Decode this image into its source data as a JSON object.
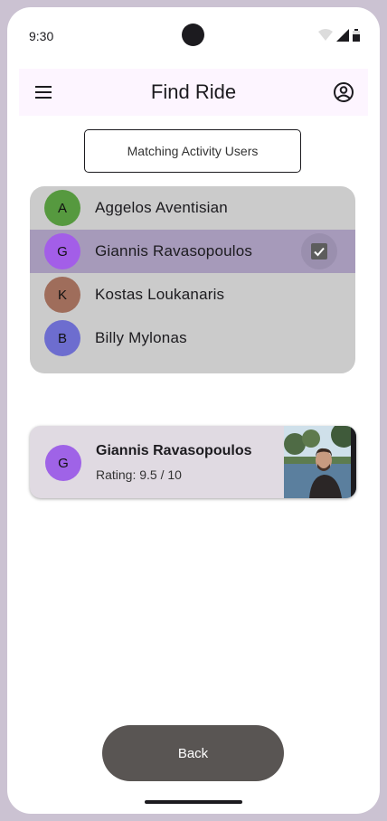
{
  "status_bar": {
    "time": "9:30"
  },
  "app_bar": {
    "title": "Find Ride"
  },
  "matching_button": {
    "label": "Matching Activity Users"
  },
  "users": [
    {
      "initial": "A",
      "name": "Aggelos Aventisian",
      "color": "#56993f",
      "selected": false
    },
    {
      "initial": "G",
      "name": "Giannis Ravasopoulos",
      "color": "#a35ee8",
      "selected": true
    },
    {
      "initial": "K",
      "name": "Kostas Loukanaris",
      "color": "#9f6d5b",
      "selected": false
    },
    {
      "initial": "B",
      "name": "Billy Mylonas",
      "color": "#6d6dcf",
      "selected": false
    }
  ],
  "selected_card": {
    "initial": "G",
    "name": "Giannis Ravasopoulos",
    "rating": "Rating: 9.5 / 10"
  },
  "back_button": {
    "label": "Back"
  },
  "colors": {
    "app_bar_bg": "#fdf5ff",
    "list_bg": "#cbcbcb",
    "selected_row": "#a69aba",
    "back_button": "#595553"
  }
}
